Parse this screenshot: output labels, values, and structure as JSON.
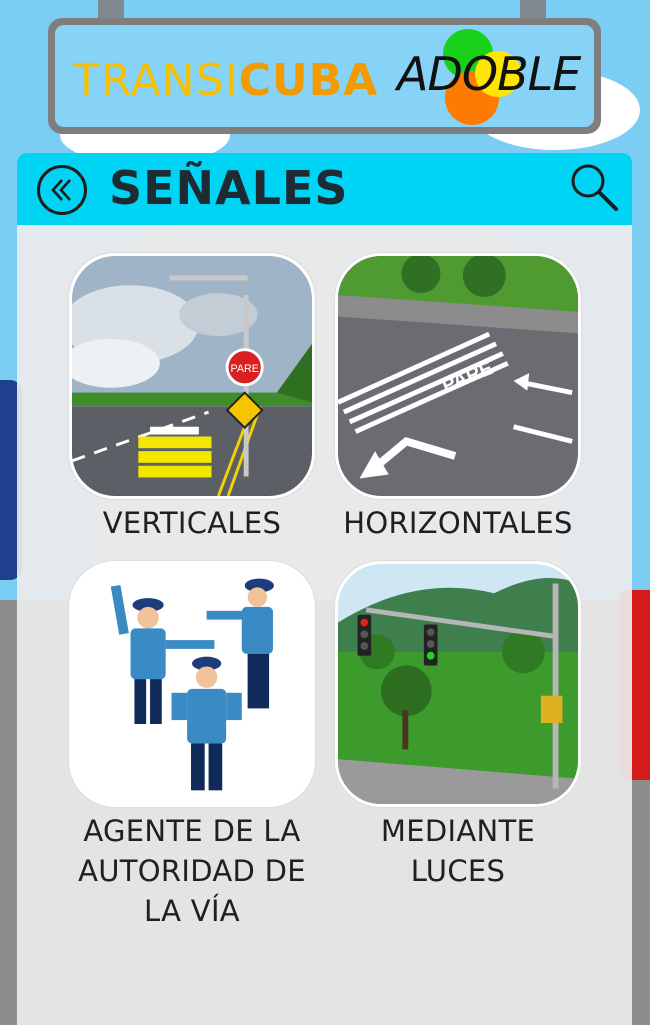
{
  "banner": {
    "brand_part1": "TRANSI",
    "brand_part2": "CUBA",
    "brand_logo": "ADOBLE"
  },
  "header": {
    "title": "SEÑALES",
    "back_icon": "double-chevron-left-icon",
    "search_icon": "search-icon"
  },
  "categories": [
    {
      "label": "VERTICALES",
      "image": "road-with-signs-image",
      "sign_text": "PARE"
    },
    {
      "label": "HORIZONTALES",
      "image": "road-markings-image",
      "marking_text": "PARE"
    },
    {
      "label": "AGENTE DE LA AUTORIDAD DE LA VÍA",
      "image": "traffic-police-image"
    },
    {
      "label": "MEDIANTE LUCES",
      "image": "traffic-light-image"
    }
  ],
  "colors": {
    "header_bg": "#00d4f5",
    "title_text": "#1f2b33",
    "brand_yellow": "#f6c000",
    "brand_orange": "#f29a00"
  }
}
